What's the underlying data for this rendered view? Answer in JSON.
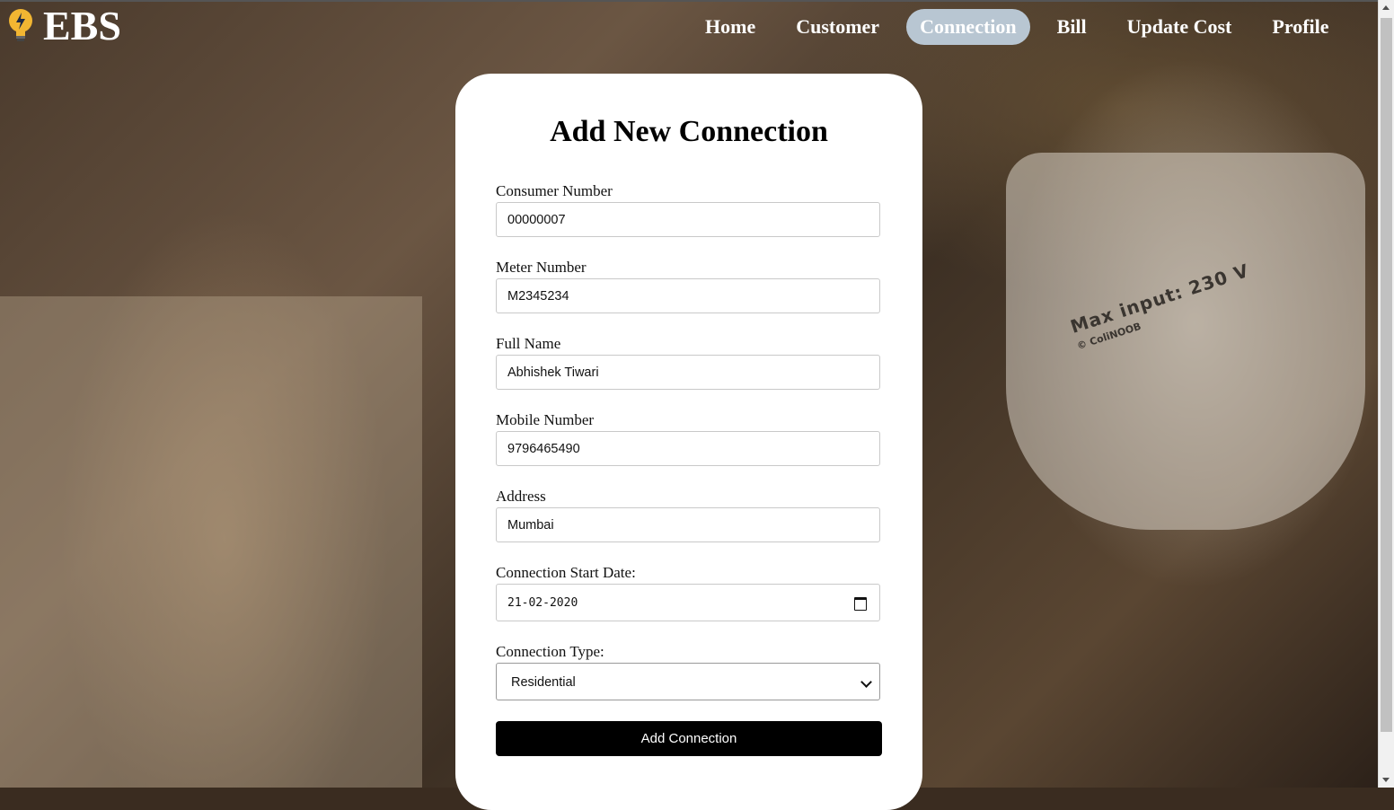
{
  "app": {
    "brand": "EBS"
  },
  "nav": {
    "items": [
      {
        "label": "Home"
      },
      {
        "label": "Customer"
      },
      {
        "label": "Connection"
      },
      {
        "label": "Bill"
      },
      {
        "label": "Update Cost"
      },
      {
        "label": "Profile"
      }
    ],
    "active": "Connection",
    "active_color": "#b8c6d2"
  },
  "background": {
    "printed_text": "Max input: 230 V",
    "printed_small": "© ColiNOOB"
  },
  "form": {
    "title": "Add New Connection",
    "consumer_number": {
      "label": "Consumer Number",
      "value": "00000007"
    },
    "meter_number": {
      "label": "Meter Number",
      "value": "M2345234"
    },
    "full_name": {
      "label": "Full Name",
      "value": "Abhishek Tiwari"
    },
    "mobile_number": {
      "label": "Mobile Number",
      "value": "9796465490"
    },
    "address": {
      "label": "Address",
      "value": "Mumbai"
    },
    "start_date": {
      "label": "Connection Start Date:",
      "value": "21-02-2020"
    },
    "connection_type": {
      "label": "Connection Type:",
      "value": "Residential"
    },
    "submit_label": "Add Connection"
  }
}
